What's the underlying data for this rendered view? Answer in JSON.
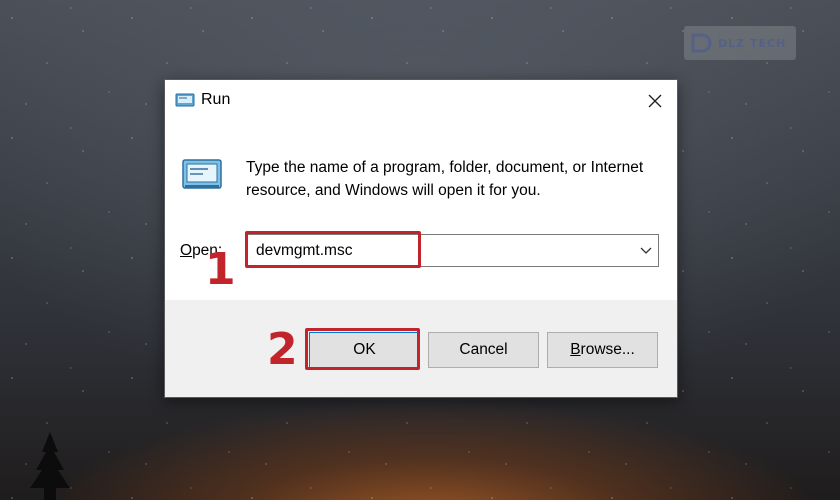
{
  "window": {
    "title": "Run",
    "close_icon": "close-icon",
    "app_icon": "run-icon"
  },
  "dialog": {
    "description": "Type the name of a program, folder, document, or Internet resource, and Windows will open it for you.",
    "open_label_mnemonic": "O",
    "open_label_rest": "pen:",
    "open_value": "devmgmt.msc"
  },
  "buttons": {
    "ok": "OK",
    "cancel": "Cancel",
    "browse_mnemonic": "B",
    "browse_rest": "rowse..."
  },
  "annotations": {
    "step1": "1",
    "step2": "2",
    "highlight_color": "#c2242c"
  },
  "watermark": {
    "text": "DLZ TECH"
  },
  "colors": {
    "dialog_bg": "#ffffff",
    "button_bar_bg": "#f0f0f0",
    "button_bg": "#e1e1e1",
    "default_button_border": "#0078d7"
  }
}
